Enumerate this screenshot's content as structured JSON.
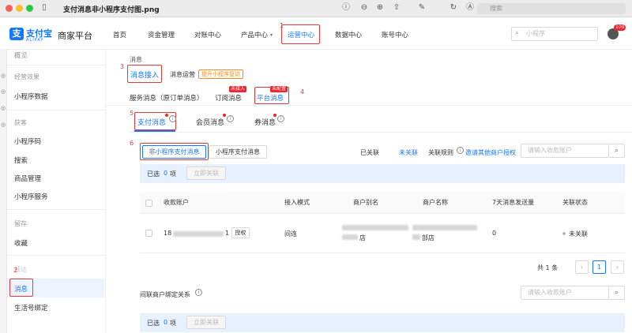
{
  "window": {
    "title": "支付消息非小程序支付图.png",
    "search_placeholder": "搜索"
  },
  "header": {
    "logo_text": "支付宝",
    "logo_sub": "ALIPAY",
    "brand": "商家平台",
    "nav": [
      "首页",
      "资金管理",
      "对账中心",
      "产品中心",
      "运营中心",
      "数据中心",
      "账号中心"
    ],
    "search_placeholder": "小程序",
    "notification_count": "109"
  },
  "annotations": [
    "1",
    "2",
    "3",
    "4",
    "5",
    "6"
  ],
  "sidebar": {
    "top_cut": "概览",
    "groups": [
      {
        "label": "经营效果",
        "items": [
          "小程序数据"
        ]
      },
      {
        "label": "获客",
        "items": [
          "小程序码",
          "搜索",
          "商品管理",
          "小程序服务"
        ]
      },
      {
        "label": "留存",
        "items": [
          "收藏"
        ]
      },
      {
        "label": "触达",
        "items": [
          "消息",
          "生活号绑定"
        ]
      }
    ]
  },
  "content": {
    "title": "消息",
    "tabs": [
      "消息接入",
      "消息运营"
    ],
    "promo_tag": "提升小程序复访",
    "subtabs": [
      "服务消息（原订单消息）",
      "订阅消息",
      "平台消息"
    ],
    "subtab_tags": [
      "未接入",
      "未配置"
    ],
    "platform_tabs": [
      "支付消息",
      "会员消息",
      "券消息"
    ],
    "pay_type_buttons": [
      "非小程序支付消息",
      "小程序支付消息"
    ],
    "linked_label": "已关联",
    "unlinked_label": "未关联",
    "rule_label": "关联规则",
    "invite_link": "邀请其他商户授权",
    "account_search_placeholder": "请输入收款账户",
    "selected_prefix": "已选",
    "selected_count": "0",
    "selected_suffix": "项",
    "action_button": "立即关联",
    "table_headers": [
      "收款账户",
      "接入模式",
      "商户别名",
      "商户名称",
      "7天消息发送量",
      "关联状态"
    ],
    "rows": [
      {
        "account_prefix": "18",
        "account_suffix": "1",
        "auth_button": "授权",
        "mode": "间连",
        "alias_tail": "店",
        "name_tail": "部店",
        "sent": "0",
        "status": "未关联"
      }
    ],
    "pagination_total": "共 1 条",
    "pagination_page": "1",
    "indirect_title": "间联商户绑定关系",
    "indirect_search_placeholder": "请输入收款账户"
  }
}
